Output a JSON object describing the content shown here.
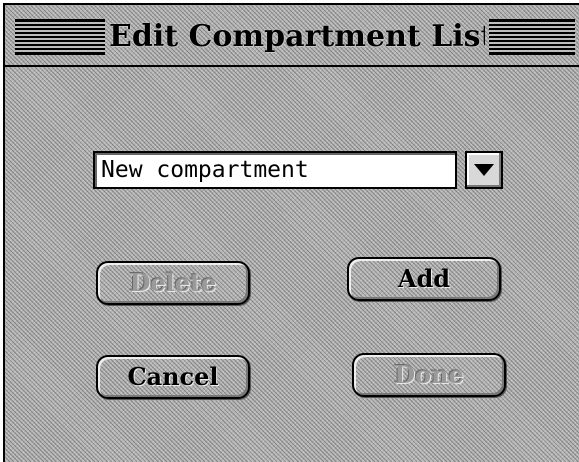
{
  "dialog": {
    "title": "Edit Compartment List",
    "compartment_field": {
      "value": "New compartment",
      "dropdown_icon": "triangle-down-icon"
    },
    "buttons": {
      "delete": {
        "label": "Delete",
        "enabled": false
      },
      "add": {
        "label": "Add",
        "enabled": true
      },
      "cancel": {
        "label": "Cancel",
        "enabled": true
      },
      "done": {
        "label": "Done",
        "enabled": false
      }
    }
  }
}
